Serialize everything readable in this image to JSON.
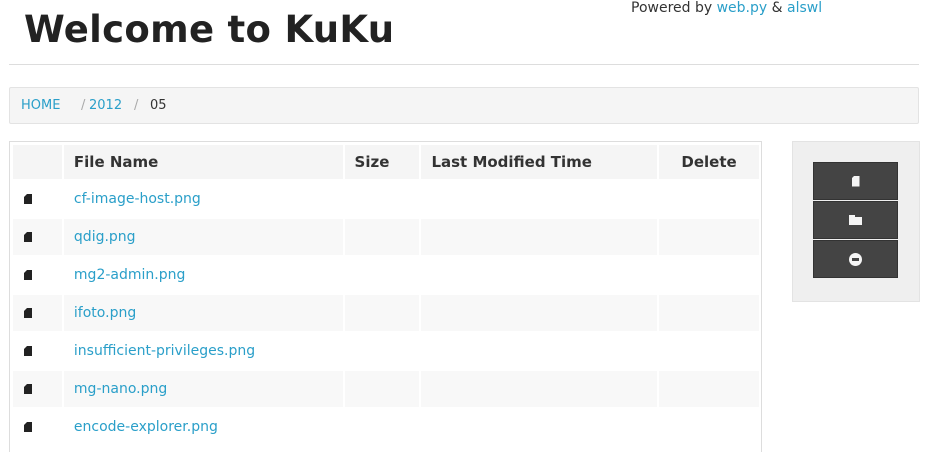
{
  "header": {
    "title": "Welcome to KuKu",
    "powered_prefix": "Powered by",
    "powered_link1": "web.py",
    "powered_amp": "&",
    "powered_link2": "alswl"
  },
  "breadcrumb": {
    "items": [
      "HOME",
      "2012"
    ],
    "separator": "/",
    "current": "05"
  },
  "table": {
    "columns": [
      "",
      "File Name",
      "Size",
      "Last Modified Time",
      "Delete"
    ],
    "rows": [
      {
        "icon": "file-icon",
        "name": "cf-image-host.png",
        "size": "",
        "modified": "",
        "delete": ""
      },
      {
        "icon": "file-icon",
        "name": "qdig.png",
        "size": "",
        "modified": "",
        "delete": ""
      },
      {
        "icon": "file-icon",
        "name": "mg2-admin.png",
        "size": "",
        "modified": "",
        "delete": ""
      },
      {
        "icon": "file-icon",
        "name": "ifoto.png",
        "size": "",
        "modified": "",
        "delete": ""
      },
      {
        "icon": "file-icon",
        "name": "insufficient-privileges.png",
        "size": "",
        "modified": "",
        "delete": ""
      },
      {
        "icon": "file-icon",
        "name": "mg-nano.png",
        "size": "",
        "modified": "",
        "delete": ""
      },
      {
        "icon": "file-icon",
        "name": "encode-explorer.png",
        "size": "",
        "modified": "",
        "delete": ""
      }
    ]
  },
  "sidebar": {
    "actions": [
      {
        "icon": "new-file-icon"
      },
      {
        "icon": "new-folder-icon"
      },
      {
        "icon": "remove-circle-icon"
      }
    ]
  },
  "colors": {
    "link": "#2a9fc9",
    "button": "#444444",
    "panel": "#f5f5f5"
  }
}
